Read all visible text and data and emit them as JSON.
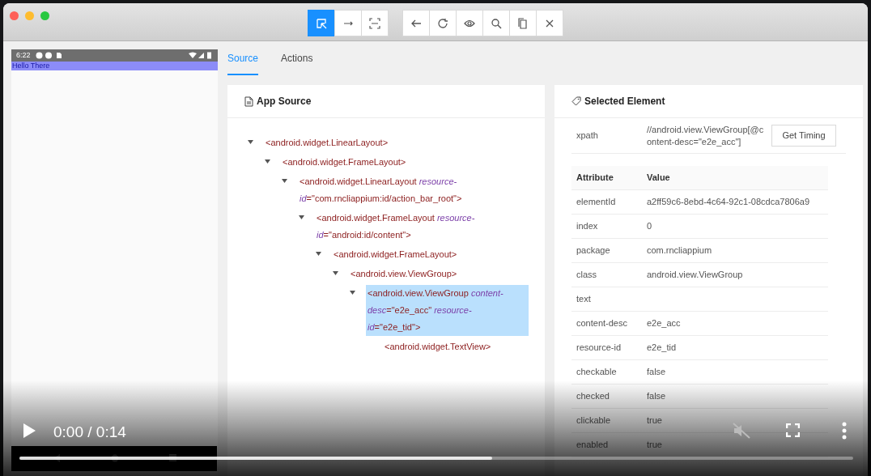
{
  "toolbar": {
    "groups": [
      {
        "buttons": [
          {
            "selected": true
          },
          {
            "selected": false
          },
          {
            "selected": false
          }
        ]
      },
      {
        "buttons": [
          {
            "selected": false
          },
          {
            "selected": false
          },
          {
            "selected": false
          },
          {
            "selected": false
          },
          {
            "selected": false
          },
          {
            "selected": false
          }
        ]
      }
    ]
  },
  "device": {
    "status_time": "6:22",
    "app_text": "Hello There"
  },
  "tabs": [
    {
      "label": "Source",
      "selected": true
    },
    {
      "label": "Actions",
      "selected": false
    }
  ],
  "app_source": {
    "title": "App Source",
    "tree": [
      {
        "label": "<android.widget.LinearLayout>",
        "expanded": true,
        "selected": false,
        "children": [
          {
            "label": "<android.widget.FrameLayout>",
            "expanded": true,
            "selected": false,
            "children": [
              {
                "label": "<android.widget.LinearLayout *resource-id*=\"com.rncliappium:id/action_bar_root\">",
                "expanded": true,
                "selected": false,
                "children": [
                  {
                    "label": "<android.widget.FrameLayout *resource-id*=\"android:id/content\">",
                    "expanded": true,
                    "selected": false,
                    "children": [
                      {
                        "label": "<android.widget.FrameLayout>",
                        "expanded": true,
                        "selected": false,
                        "children": [
                          {
                            "label": "<android.view.ViewGroup>",
                            "expanded": true,
                            "selected": false,
                            "children": [
                              {
                                "label": "<android.view.ViewGroup *content-desc*=\"e2e_acc\" *resource-id*=\"e2e_tid\">",
                                "expanded": true,
                                "selected": true,
                                "children": [
                                  {
                                    "label": "<android.widget.TextView>",
                                    "selected": false
                                  }
                                ]
                              }
                            ]
                          }
                        ]
                      }
                    ]
                  }
                ]
              }
            ]
          }
        ]
      }
    ]
  },
  "selected_element": {
    "title": "Selected Element",
    "xpath_label": "xpath",
    "xpath": "//android.view.ViewGroup[@content-desc=\"e2e_acc\"]",
    "timing_button": "Get Timing",
    "columns": [
      "Attribute",
      "Value"
    ],
    "rows": [
      {
        "attribute": "elementId",
        "value": "a2ff59c6-8ebd-4c64-92c1-08cdca7806a9"
      },
      {
        "attribute": "index",
        "value": "0"
      },
      {
        "attribute": "package",
        "value": "com.rncliappium"
      },
      {
        "attribute": "class",
        "value": "android.view.ViewGroup"
      },
      {
        "attribute": "text"
      },
      {
        "attribute": "content-desc",
        "value": "e2e_acc"
      },
      {
        "attribute": "resource-id",
        "value": "e2e_tid"
      },
      {
        "attribute": "checkable",
        "value": "false"
      },
      {
        "attribute": "checked",
        "value": "false"
      },
      {
        "attribute": "clickable",
        "value": "true"
      },
      {
        "attribute": "enabled",
        "value": "true"
      }
    ]
  },
  "video": {
    "time": "0:00 / 0:14",
    "muted": true,
    "level": 0.567
  }
}
